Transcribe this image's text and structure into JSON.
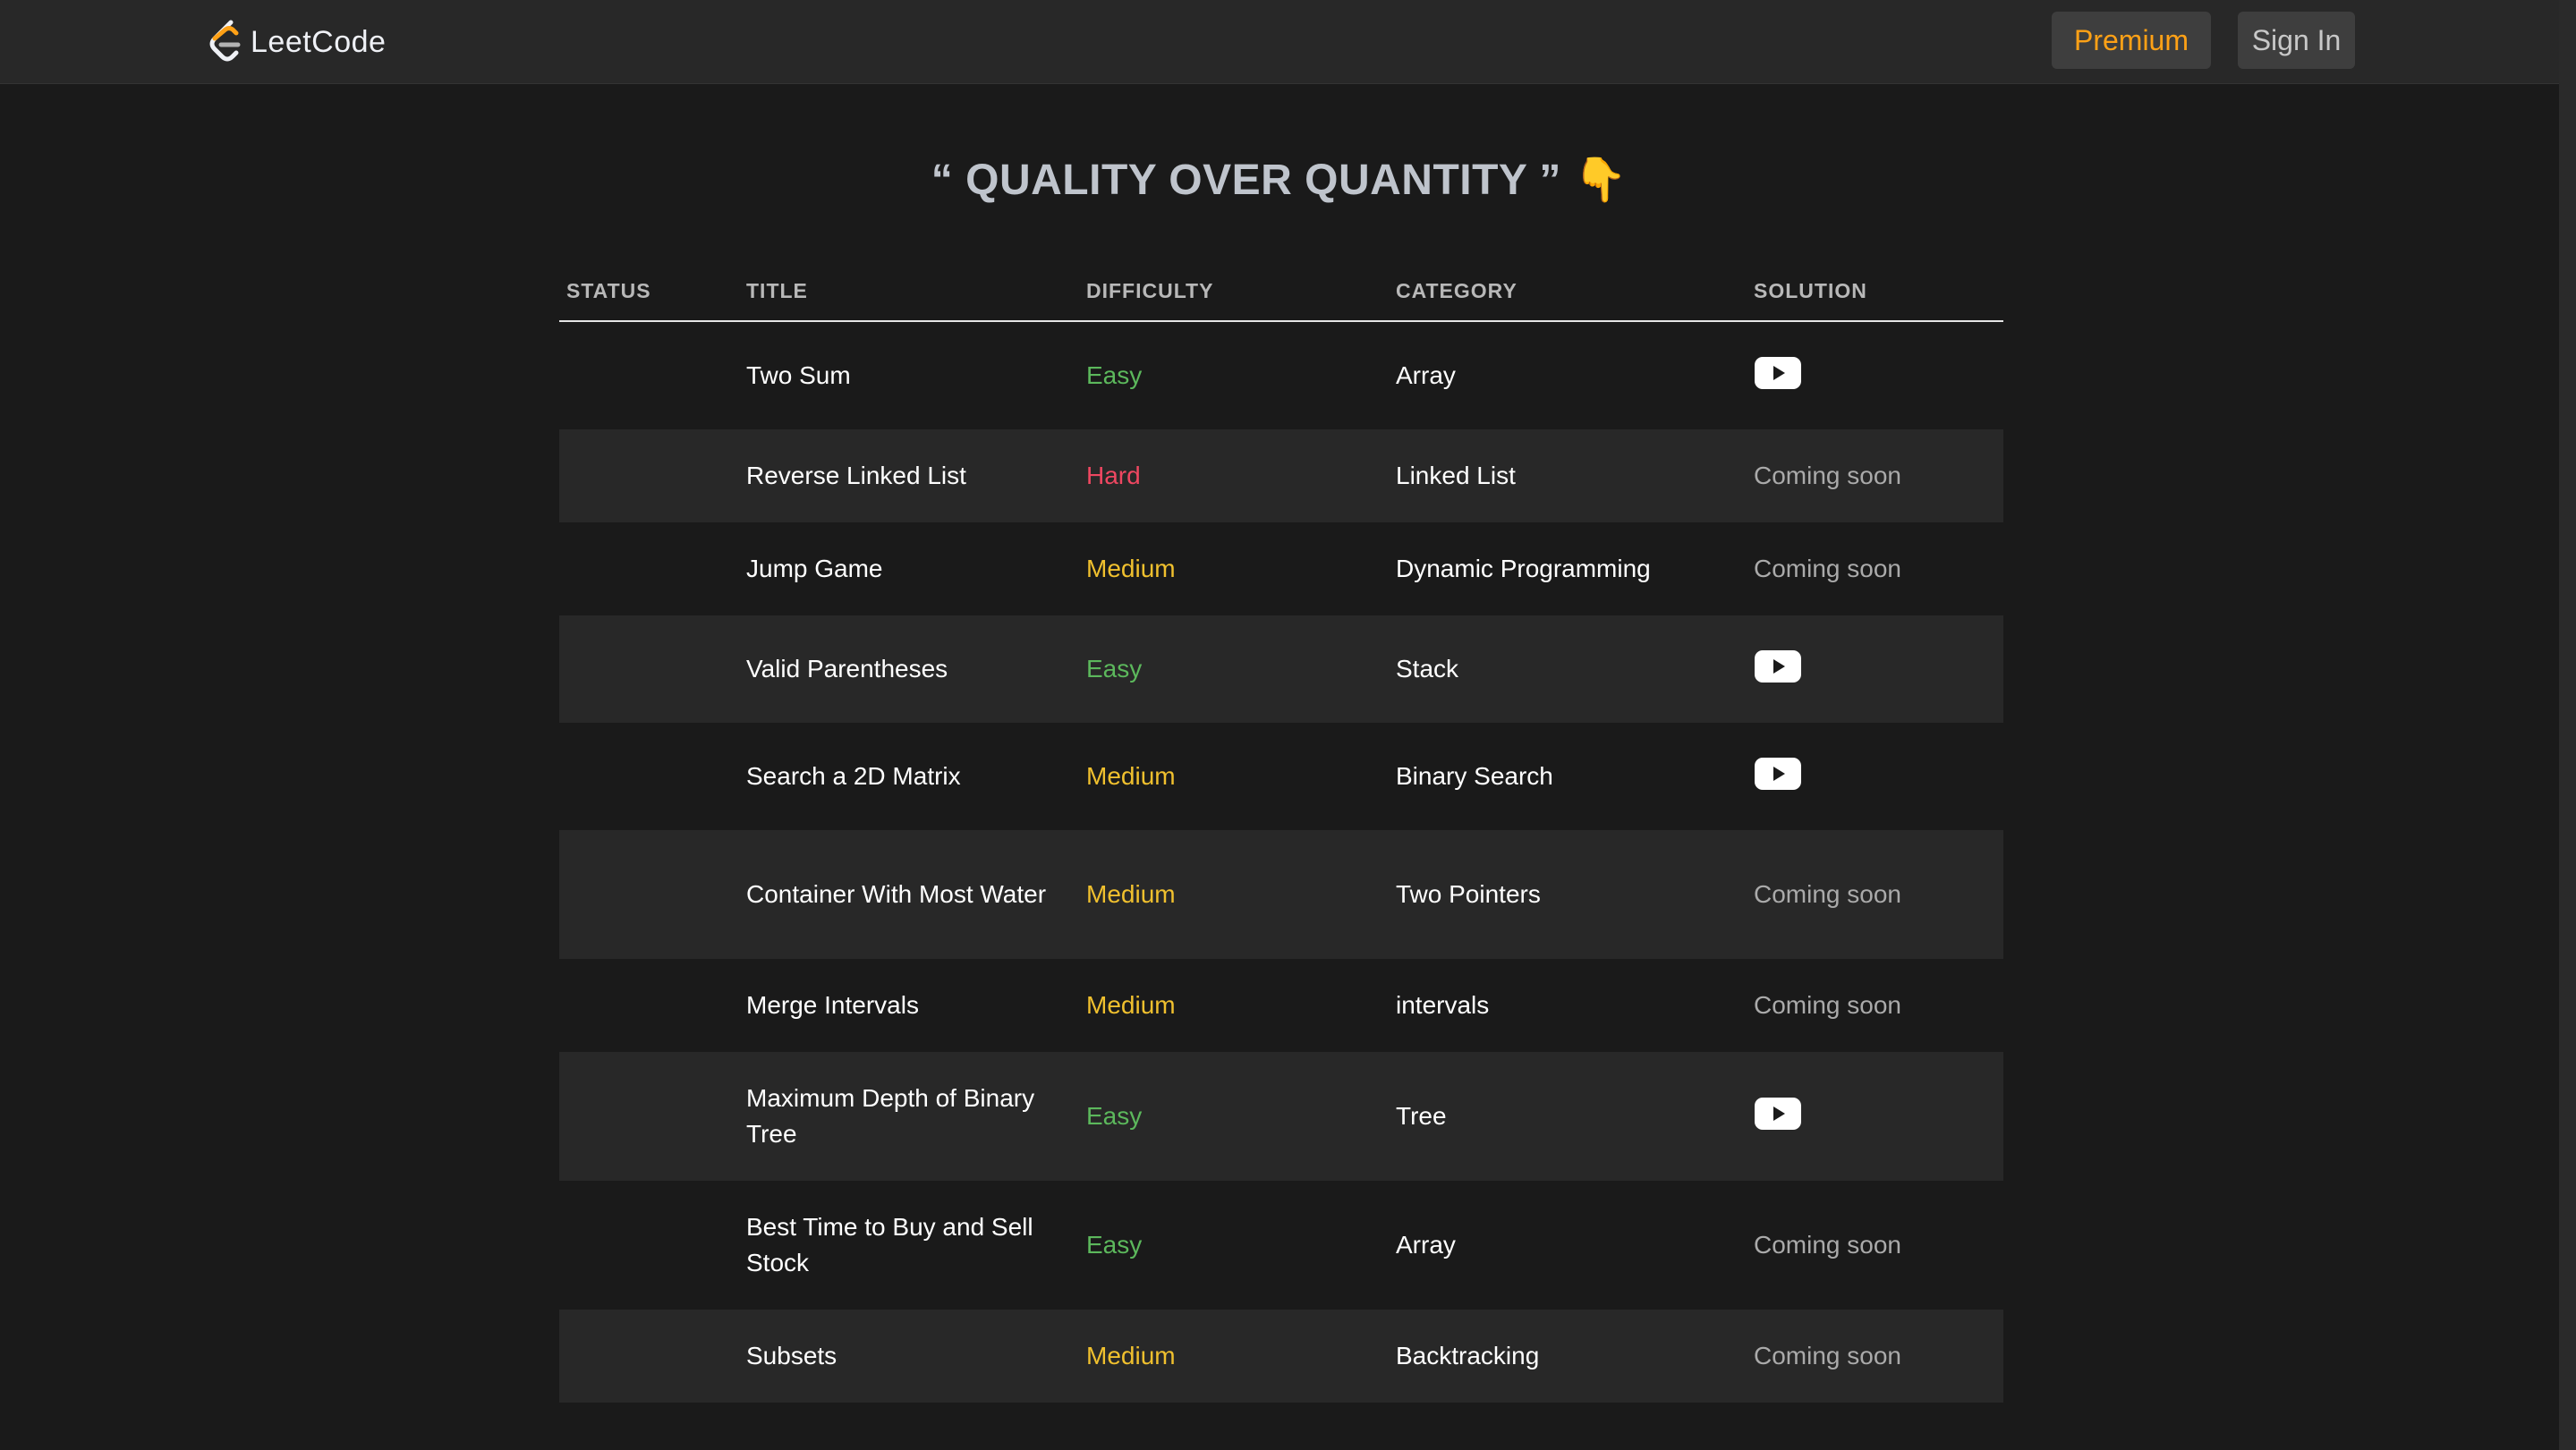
{
  "header": {
    "brand": "LeetCode",
    "premium_label": "Premium",
    "signin_label": "Sign In"
  },
  "heading": {
    "text": "“ QUALITY OVER QUANTITY ”",
    "emoji": "👇"
  },
  "table": {
    "columns": [
      "STATUS",
      "TITLE",
      "DIFFICULTY",
      "CATEGORY",
      "SOLUTION"
    ],
    "rows": [
      {
        "title": "Two Sum",
        "difficulty": "Easy",
        "category": "Array",
        "solution": "video",
        "solution_text": ""
      },
      {
        "title": "Reverse Linked List",
        "difficulty": "Hard",
        "category": "Linked List",
        "solution": "text",
        "solution_text": "Coming soon"
      },
      {
        "title": "Jump Game",
        "difficulty": "Medium",
        "category": "Dynamic Programming",
        "solution": "text",
        "solution_text": "Coming soon"
      },
      {
        "title": "Valid Parentheses",
        "difficulty": "Easy",
        "category": "Stack",
        "solution": "video",
        "solution_text": ""
      },
      {
        "title": "Search a 2D Matrix",
        "difficulty": "Medium",
        "category": "Binary Search",
        "solution": "video",
        "solution_text": ""
      },
      {
        "title": "Container With Most Water",
        "difficulty": "Medium",
        "category": "Two Pointers",
        "solution": "text",
        "solution_text": "Coming soon"
      },
      {
        "title": "Merge Intervals",
        "difficulty": "Medium",
        "category": "intervals",
        "solution": "text",
        "solution_text": "Coming soon"
      },
      {
        "title": "Maximum Depth of Binary Tree",
        "difficulty": "Easy",
        "category": "Tree",
        "solution": "video",
        "solution_text": ""
      },
      {
        "title": "Best Time to Buy and Sell Stock",
        "difficulty": "Easy",
        "category": "Array",
        "solution": "text",
        "solution_text": "Coming soon"
      },
      {
        "title": "Subsets",
        "difficulty": "Medium",
        "category": "Backtracking",
        "solution": "text",
        "solution_text": "Coming soon"
      }
    ]
  },
  "colors": {
    "easy": "#5cb85c",
    "medium": "#f0c02e",
    "hard": "#ef4761",
    "premium": "#ffa116"
  },
  "icons": {
    "logo": "leetcode-logo-icon",
    "solution": "youtube-play-icon"
  }
}
